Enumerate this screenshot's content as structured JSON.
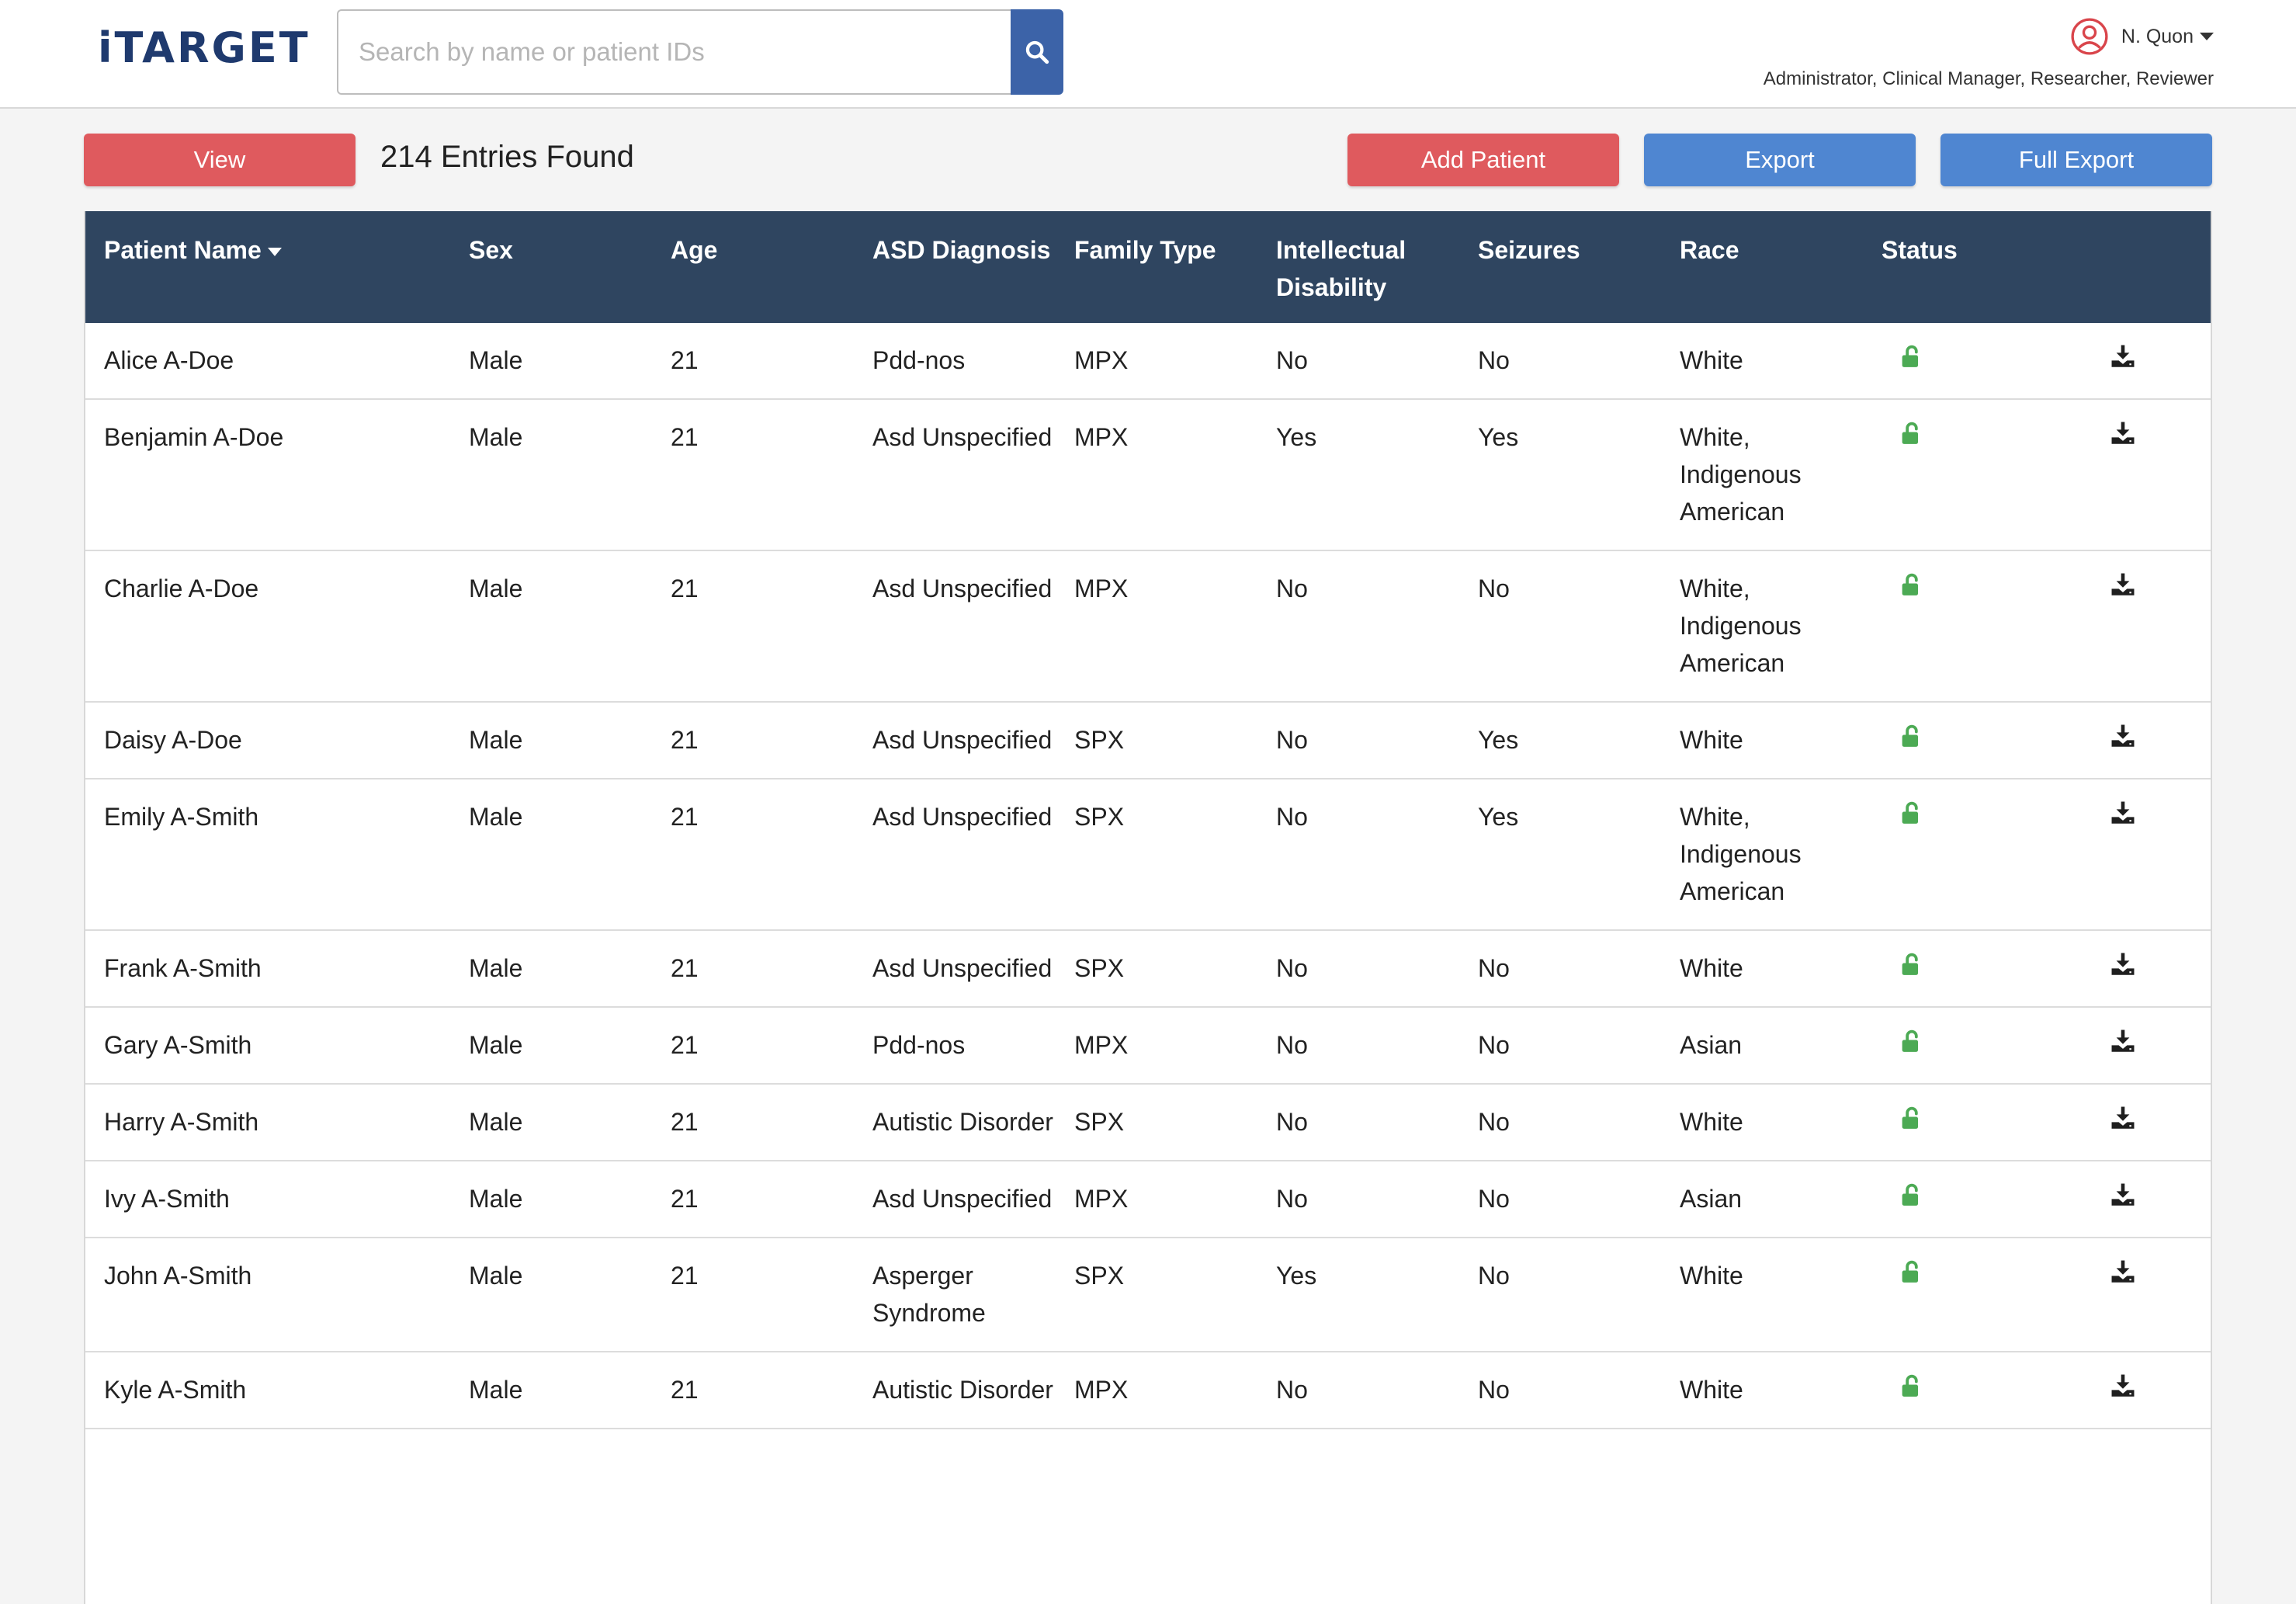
{
  "app": {
    "logo": "iTARGET"
  },
  "search": {
    "placeholder": "Search by name or patient IDs"
  },
  "user": {
    "name": "N. Quon",
    "roles": "Administrator, Clinical Manager, Researcher, Reviewer"
  },
  "toolbar": {
    "view_label": "View",
    "entries_text": "214 Entries Found",
    "add_patient_label": "Add Patient",
    "export_label": "Export",
    "full_export_label": "Full Export"
  },
  "colors": {
    "header_bg": "#2f4560",
    "red_button": "#df5a5e",
    "blue_button": "#4f86d1",
    "unlock_green": "#4caa54"
  },
  "table": {
    "columns": [
      "Patient Name",
      "Sex",
      "Age",
      "ASD Diagnosis",
      "Family Type",
      "Intellectual Disability",
      "Seizures",
      "Race",
      "Status",
      ""
    ],
    "rows": [
      {
        "name": "Alice A-Doe",
        "sex": "Male",
        "age": "21",
        "diagnosis": "Pdd-nos",
        "family": "MPX",
        "intellectual": "No",
        "seizures": "No",
        "race": "White",
        "status_icon": "unlock-icon",
        "action_icon": "download-icon"
      },
      {
        "name": "Benjamin A-Doe",
        "sex": "Male",
        "age": "21",
        "diagnosis": "Asd Unspecified",
        "family": "MPX",
        "intellectual": "Yes",
        "seizures": "Yes",
        "race": "White, Indigenous American",
        "status_icon": "unlock-icon",
        "action_icon": "download-icon"
      },
      {
        "name": "Charlie A-Doe",
        "sex": "Male",
        "age": "21",
        "diagnosis": "Asd Unspecified",
        "family": "MPX",
        "intellectual": "No",
        "seizures": "No",
        "race": "White, Indigenous American",
        "status_icon": "unlock-icon",
        "action_icon": "download-icon"
      },
      {
        "name": "Daisy A-Doe",
        "sex": "Male",
        "age": "21",
        "diagnosis": "Asd Unspecified",
        "family": "SPX",
        "intellectual": "No",
        "seizures": "Yes",
        "race": "White",
        "status_icon": "unlock-icon",
        "action_icon": "download-icon"
      },
      {
        "name": "Emily A-Smith",
        "sex": "Male",
        "age": "21",
        "diagnosis": "Asd Unspecified",
        "family": "SPX",
        "intellectual": "No",
        "seizures": "Yes",
        "race": "White, Indigenous American",
        "status_icon": "unlock-icon",
        "action_icon": "download-icon"
      },
      {
        "name": "Frank A-Smith",
        "sex": "Male",
        "age": "21",
        "diagnosis": "Asd Unspecified",
        "family": "SPX",
        "intellectual": "No",
        "seizures": "No",
        "race": "White",
        "status_icon": "unlock-icon",
        "action_icon": "download-icon"
      },
      {
        "name": "Gary A-Smith",
        "sex": "Male",
        "age": "21",
        "diagnosis": "Pdd-nos",
        "family": "MPX",
        "intellectual": "No",
        "seizures": "No",
        "race": "Asian",
        "status_icon": "unlock-icon",
        "action_icon": "download-icon"
      },
      {
        "name": "Harry A-Smith",
        "sex": "Male",
        "age": "21",
        "diagnosis": "Autistic Disorder",
        "family": "SPX",
        "intellectual": "No",
        "seizures": "No",
        "race": "White",
        "status_icon": "unlock-icon",
        "action_icon": "download-icon"
      },
      {
        "name": "Ivy A-Smith",
        "sex": "Male",
        "age": "21",
        "diagnosis": "Asd Unspecified",
        "family": "MPX",
        "intellectual": "No",
        "seizures": "No",
        "race": "Asian",
        "status_icon": "unlock-icon",
        "action_icon": "download-icon"
      },
      {
        "name": "John A-Smith",
        "sex": "Male",
        "age": "21",
        "diagnosis": "Asperger Syndrome",
        "family": "SPX",
        "intellectual": "Yes",
        "seizures": "No",
        "race": "White",
        "status_icon": "unlock-icon",
        "action_icon": "download-icon"
      },
      {
        "name": "Kyle A-Smith",
        "sex": "Male",
        "age": "21",
        "diagnosis": "Autistic Disorder",
        "family": "MPX",
        "intellectual": "No",
        "seizures": "No",
        "race": "White",
        "status_icon": "unlock-icon",
        "action_icon": "download-icon"
      }
    ]
  }
}
